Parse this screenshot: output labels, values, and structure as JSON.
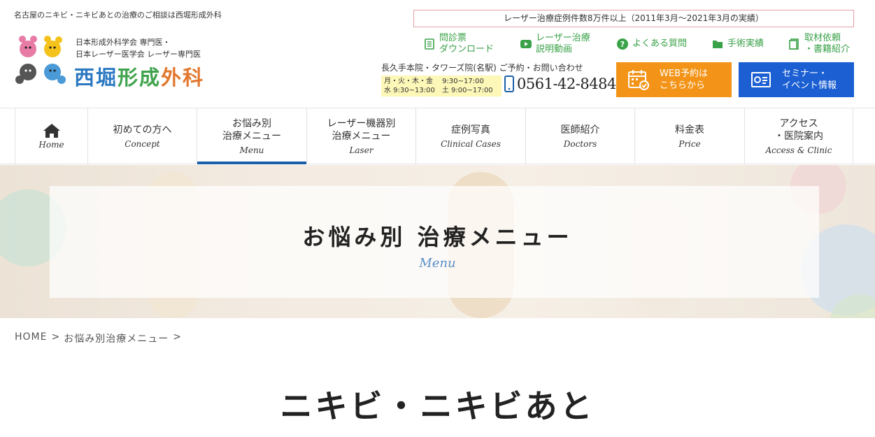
{
  "header": {
    "tagline": "名古屋のニキビ・ニキビあとの治療のご相談は西堀形成外科",
    "notice": "レーザー治療症例件数8万件以上（2011年3月～2021年3月の実績）",
    "logo": {
      "line1": "日本形成外科学会 専門医・",
      "line2": "日本レーザー医学会 レーザー専門医",
      "name_part1": "西堀",
      "name_part2": "形成",
      "name_part3": "外科"
    },
    "links": [
      {
        "label": "問診票\nダウンロード",
        "icon": "document-icon"
      },
      {
        "label": "レーザー治療\n説明動画",
        "icon": "video-play-icon"
      },
      {
        "label": "よくある質問",
        "icon": "question-icon"
      },
      {
        "label": "手術実績",
        "icon": "folder-icon"
      },
      {
        "label": "取材依頼\n・書籍紹介",
        "icon": "book-icon"
      }
    ],
    "contact": {
      "title": "長久手本院・タワーズ院(名駅) ご予約・お問い合わせ",
      "hours1": "月・火・木・金　 9:30~17:00",
      "hours2": "水 9:30~13:00　土 9:00~17:00",
      "phone": "0561-42-8484"
    },
    "cta_web": "WEB予約は\nこちらから",
    "cta_seminar": "セミナー・\nイベント情報",
    "colors": {
      "accent_green": "#3aa248",
      "orange": "#f39418",
      "blue": "#1b5fd3",
      "nav_active": "#1b5fa8"
    }
  },
  "nav": {
    "items": [
      {
        "jp": "",
        "en": "Home",
        "icon": "home-icon"
      },
      {
        "jp": "初めての方へ",
        "en": "Concept"
      },
      {
        "jp": "お悩み別\n治療メニュー",
        "en": "Menu",
        "active": true
      },
      {
        "jp": "レーザー機器別\n治療メニュー",
        "en": "Laser"
      },
      {
        "jp": "症例写真",
        "en": "Clinical Cases"
      },
      {
        "jp": "医師紹介",
        "en": "Doctors"
      },
      {
        "jp": "料金表",
        "en": "Price"
      },
      {
        "jp": "アクセス\n・医院案内",
        "en": "Access & Clinic"
      }
    ]
  },
  "hero": {
    "title": "お悩み別 治療メニュー",
    "subtitle": "Menu"
  },
  "breadcrumb": {
    "home": "HOME",
    "sep1": ">",
    "current": "お悩み別治療メニュー",
    "sep2": ">"
  },
  "page": {
    "heading": "ニキビ・ニキビあと"
  }
}
